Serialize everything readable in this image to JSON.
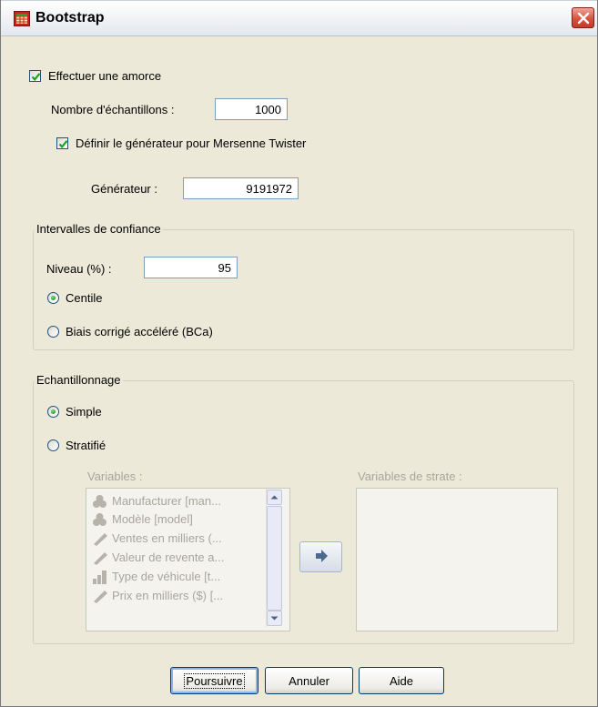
{
  "window": {
    "title": "Bootstrap"
  },
  "bootstrap": {
    "perform_label": "Effectuer une amorce",
    "perform_checked": true,
    "samples_label": "Nombre d'échantillons :",
    "samples_value": "1000",
    "set_seed_label": "Définir le générateur pour Mersenne Twister",
    "set_seed_checked": true,
    "seed_label": "Générateur :",
    "seed_value": "9191972"
  },
  "confidence": {
    "group_title": "Intervalles de confiance",
    "level_label": "Niveau (%) :",
    "level_value": "95",
    "options": [
      {
        "label": "Centile",
        "selected": true
      },
      {
        "label": "Biais corrigé accéléré (BCa)",
        "selected": false
      }
    ]
  },
  "sampling": {
    "group_title": "Echantillonnage",
    "options": [
      {
        "label": "Simple",
        "selected": true
      },
      {
        "label": "Stratifié",
        "selected": false
      }
    ],
    "variables_label": "Variables :",
    "strata_label": "Variables de strate :",
    "variables": [
      {
        "icon": "nominal-icon",
        "label": "Manufacturer [man..."
      },
      {
        "icon": "nominal-icon",
        "label": "Modèle [model]"
      },
      {
        "icon": "scale-icon",
        "label": "Ventes en milliers (..."
      },
      {
        "icon": "scale-icon",
        "label": "Valeur de revente a..."
      },
      {
        "icon": "ordinal-icon",
        "label": "Type de véhicule [t..."
      },
      {
        "icon": "scale-icon",
        "label": "Prix en milliers ($) [..."
      }
    ]
  },
  "buttons": {
    "continue": "Poursuivre",
    "cancel": "Annuler",
    "help": "Aide"
  }
}
